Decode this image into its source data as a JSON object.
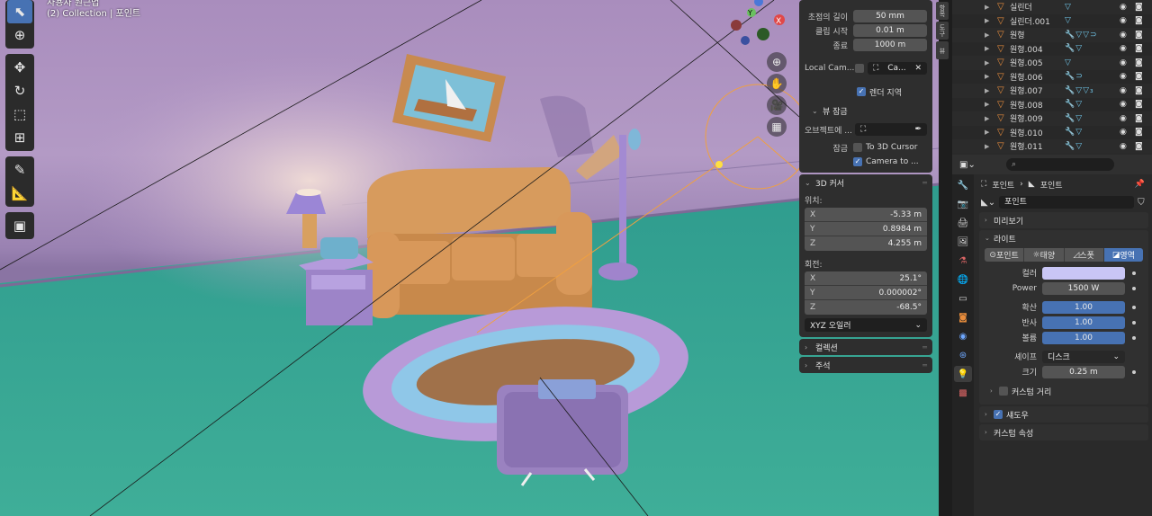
{
  "viewport": {
    "title_line1": "사용자 원근법",
    "title_line2": "(2) Collection | 포인트"
  },
  "npanel": {
    "focal_length": {
      "label": "초점의 길이",
      "value": "50 mm"
    },
    "clip_start": {
      "label": "클립 시작",
      "value": "0.01 m"
    },
    "clip_end": {
      "label": "종료",
      "value": "1000 m"
    },
    "local_camera": {
      "label": "Local Cam...",
      "value": "Ca..."
    },
    "render_region": "렌더 지역",
    "view_lock": {
      "title": "뷰 잠금",
      "object_label": "오브젝트에 ...",
      "lock_label": "잠금",
      "to_3d_cursor": "To 3D Cursor",
      "camera_to": "Camera to ..."
    },
    "cursor": {
      "title": "3D 커서",
      "location_label": "위치:",
      "location": [
        {
          "axis": "X",
          "value": "-5.33 m"
        },
        {
          "axis": "Y",
          "value": "0.8984 m"
        },
        {
          "axis": "Z",
          "value": "4.255 m"
        }
      ],
      "rotation_label": "회전:",
      "rotation": [
        {
          "axis": "X",
          "value": "25.1°"
        },
        {
          "axis": "Y",
          "value": "0.000002°"
        },
        {
          "axis": "Z",
          "value": "-68.5°"
        }
      ],
      "rotation_mode": "XYZ 오일러"
    },
    "collections": "컬렉션",
    "annotations": "주석"
  },
  "side_tabs": [
    "항목",
    "도구",
    "뷰"
  ],
  "outliner": {
    "rows": [
      {
        "name": "실린더",
        "mods": "▽"
      },
      {
        "name": "실린더.001",
        "mods": "▽"
      },
      {
        "name": "원형",
        "mods": "🔧▽▽⊃"
      },
      {
        "name": "원형.004",
        "mods": "🔧▽"
      },
      {
        "name": "원형.005",
        "mods": "▽"
      },
      {
        "name": "원형.006",
        "mods": "🔧⊃"
      },
      {
        "name": "원형.007",
        "mods": "🔧▽▽₃"
      },
      {
        "name": "원형.008",
        "mods": "🔧▽"
      },
      {
        "name": "원형.009",
        "mods": "🔧▽"
      },
      {
        "name": "원형.010",
        "mods": "🔧▽"
      },
      {
        "name": "원형.011",
        "mods": "🔧▽"
      }
    ]
  },
  "properties": {
    "breadcrumb_object": "포인트",
    "breadcrumb_data": "포인트",
    "data_name": "포인트",
    "preview": "미리보기",
    "light": "라이트",
    "light_types": [
      "포인트",
      "태양",
      "스폿",
      "영역"
    ],
    "light_type_active": "영역",
    "color_label": "컬러",
    "power_label": "Power",
    "power_value": "1500 W",
    "diffuse_label": "확산",
    "diffuse_value": "1.00",
    "specular_label": "반사",
    "specular_value": "1.00",
    "volume_label": "볼륨",
    "volume_value": "1.00",
    "shape_label": "셰이프",
    "shape_value": "디스크",
    "size_label": "크기",
    "size_value": "0.25 m",
    "custom_distance": "커스텀 거리",
    "shadow": "섀도우",
    "custom_props": "커스텀 속성"
  },
  "colors": {
    "accent": "#4772b3",
    "light_color": "#c9c6f5",
    "object_orange": "#e98d3c"
  }
}
